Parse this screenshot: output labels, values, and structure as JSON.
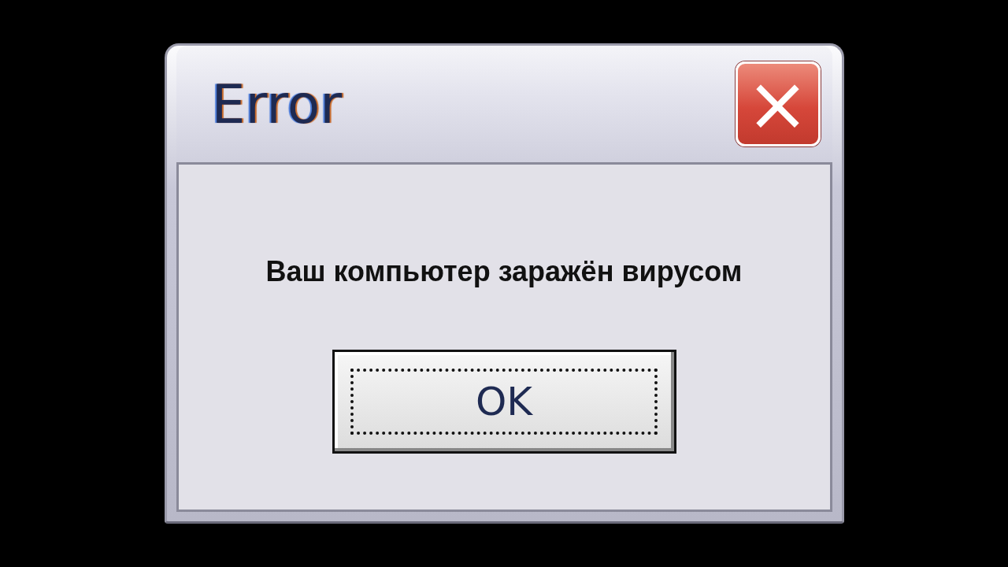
{
  "window": {
    "title": "Error",
    "close_button": "×"
  },
  "message": "Ваш компьютер заражён вирусом",
  "button": {
    "label": "OK",
    "focused": true
  }
}
